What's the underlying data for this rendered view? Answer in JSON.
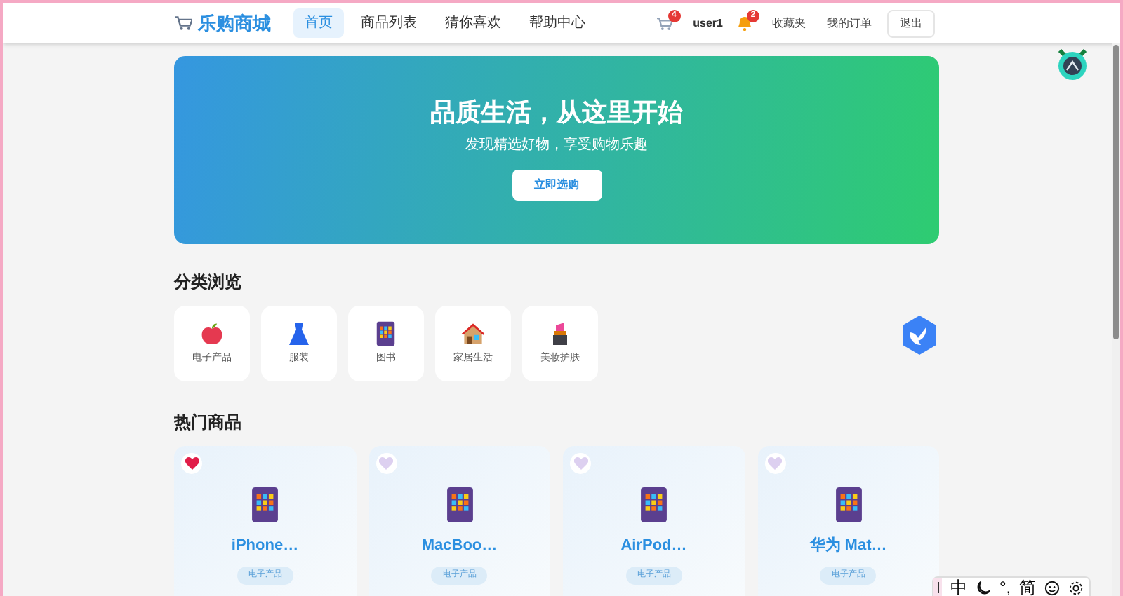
{
  "header": {
    "logo": "乐购商城",
    "nav": [
      {
        "label": "首页",
        "selected": true
      },
      {
        "label": "商品列表",
        "selected": false
      },
      {
        "label": "猜你喜欢",
        "selected": false
      },
      {
        "label": "帮助中心",
        "selected": false
      }
    ],
    "cart_badge": "4",
    "username": "user1",
    "bell_badge": "2",
    "links": [
      "收藏夹",
      "我的订单"
    ],
    "logout": "退出"
  },
  "hero": {
    "title": "品质生活，从这里开始",
    "subtitle": "发现精选好物，享受购物乐趣",
    "button": "立即选购"
  },
  "categories": {
    "title": "分类浏览",
    "items": [
      {
        "kind": "apple",
        "label": "电子产品"
      },
      {
        "kind": "dress",
        "label": "服装"
      },
      {
        "kind": "tablet",
        "label": "图书"
      },
      {
        "kind": "house",
        "label": "家居生活"
      },
      {
        "kind": "lipstick",
        "label": "美妆护肤"
      }
    ]
  },
  "products": {
    "title": "热门商品",
    "items": [
      {
        "name": "iPhone…",
        "tag": "电子产品",
        "favorited": true
      },
      {
        "name": "MacBoo…",
        "tag": "电子产品",
        "favorited": false
      },
      {
        "name": "AirPod…",
        "tag": "电子产品",
        "favorited": false
      },
      {
        "name": "华为 Mat…",
        "tag": "电子产品",
        "favorited": false
      }
    ]
  },
  "ime_bar": {
    "items": [
      {
        "kind": "text",
        "label": "中"
      },
      {
        "kind": "moon"
      },
      {
        "kind": "text",
        "label": "°,"
      },
      {
        "kind": "text",
        "label": "简"
      },
      {
        "kind": "smile"
      },
      {
        "kind": "gear"
      }
    ]
  }
}
